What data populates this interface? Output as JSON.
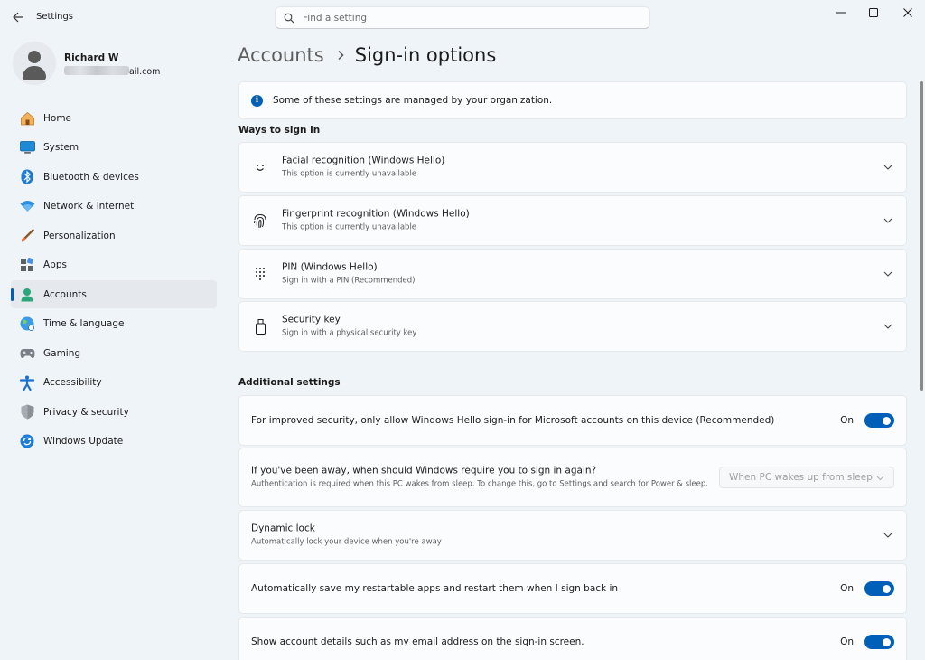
{
  "window": {
    "app_title": "Settings"
  },
  "search": {
    "placeholder": "Find a setting"
  },
  "user": {
    "name": "Richard W",
    "email_visible": "ail.com"
  },
  "nav": {
    "items": [
      {
        "label": "Home",
        "icon": "home-icon"
      },
      {
        "label": "System",
        "icon": "system-icon"
      },
      {
        "label": "Bluetooth & devices",
        "icon": "bluetooth-icon"
      },
      {
        "label": "Network & internet",
        "icon": "network-icon"
      },
      {
        "label": "Personalization",
        "icon": "brush-icon"
      },
      {
        "label": "Apps",
        "icon": "apps-icon"
      },
      {
        "label": "Accounts",
        "icon": "accounts-icon",
        "active": true
      },
      {
        "label": "Time & language",
        "icon": "globe-icon"
      },
      {
        "label": "Gaming",
        "icon": "gamepad-icon"
      },
      {
        "label": "Accessibility",
        "icon": "accessibility-icon"
      },
      {
        "label": "Privacy & security",
        "icon": "shield-icon"
      },
      {
        "label": "Windows Update",
        "icon": "update-icon"
      }
    ]
  },
  "breadcrumb": {
    "parent": "Accounts",
    "current": "Sign-in options"
  },
  "info_banner": {
    "text": "Some of these settings are managed by your organization."
  },
  "ways_section": {
    "title": "Ways to sign in",
    "items": [
      {
        "title": "Facial recognition (Windows Hello)",
        "subtitle": "This option is currently unavailable",
        "icon": "face-icon"
      },
      {
        "title": "Fingerprint recognition (Windows Hello)",
        "subtitle": "This option is currently unavailable",
        "icon": "fingerprint-icon"
      },
      {
        "title": "PIN (Windows Hello)",
        "subtitle": "Sign in with a PIN (Recommended)",
        "icon": "pin-keypad-icon"
      },
      {
        "title": "Security key",
        "subtitle": "Sign in with a physical security key",
        "icon": "usb-key-icon"
      }
    ]
  },
  "additional_section": {
    "title": "Additional settings",
    "hello_only": {
      "title": "For improved security, only allow Windows Hello sign-in for Microsoft accounts on this device (Recommended)",
      "state": "On"
    },
    "away": {
      "title": "If you've been away, when should Windows require you to sign in again?",
      "subtitle": "Authentication is required when this PC wakes from sleep. To change this, go to Settings and search for Power & sleep.",
      "select_value": "When PC wakes up from sleep"
    },
    "dynamic_lock": {
      "title": "Dynamic lock",
      "subtitle": "Automatically lock your device when you're away"
    },
    "restart_apps": {
      "title": "Automatically save my restartable apps and restart them when I sign back in",
      "state": "On"
    },
    "account_details": {
      "title": "Show account details such as my email address on the sign-in screen.",
      "state": "On"
    }
  },
  "colors": {
    "accent": "#005fb8",
    "background": "#eff4f9",
    "card": "#fbfcfd"
  }
}
